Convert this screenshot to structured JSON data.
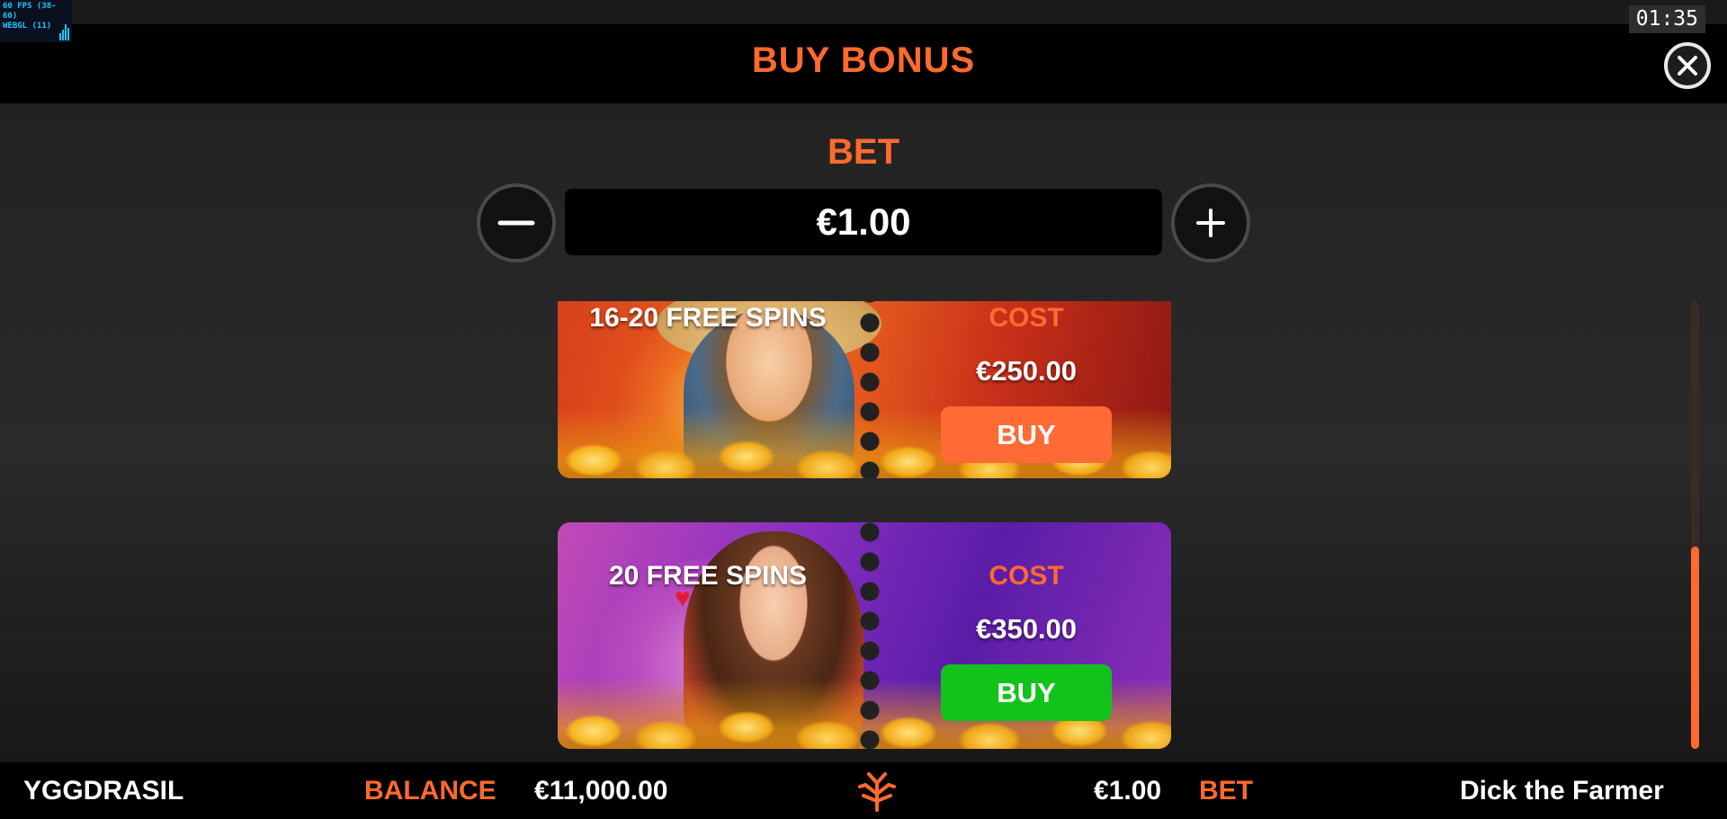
{
  "debug": {
    "fps_text": "60 FPS (38-60)",
    "renderer_text": "WEBGL (11)"
  },
  "clock": "01:35",
  "header": {
    "title": "BUY BONUS",
    "close_icon": "close-icon"
  },
  "bet_selector": {
    "label": "BET",
    "value": "€1.00",
    "decrease_icon": "minus-icon",
    "increase_icon": "plus-icon"
  },
  "bonus_options": [
    {
      "title": "16-20 FREE SPINS",
      "cost_label": "COST",
      "cost": "€250.00",
      "buy_label": "BUY",
      "buy_color": "#ff6a35",
      "character": "farmer"
    },
    {
      "title": "20 FREE SPINS",
      "cost_label": "COST",
      "cost": "€350.00",
      "buy_label": "BUY",
      "buy_color": "#12c31c",
      "character": "lady"
    }
  ],
  "footer": {
    "brand": "YGGDRASIL",
    "balance_label": "BALANCE",
    "balance_value": "€11,000.00",
    "bet_value": "€1.00",
    "bet_label": "BET",
    "game_name": "Dick the Farmer",
    "logo_icon": "yggdrasil-tree-icon"
  },
  "colors": {
    "accent": "#ff6a2e",
    "buy_green": "#12c31c",
    "buy_orange": "#ff6a35",
    "header_bg": "#000000"
  }
}
